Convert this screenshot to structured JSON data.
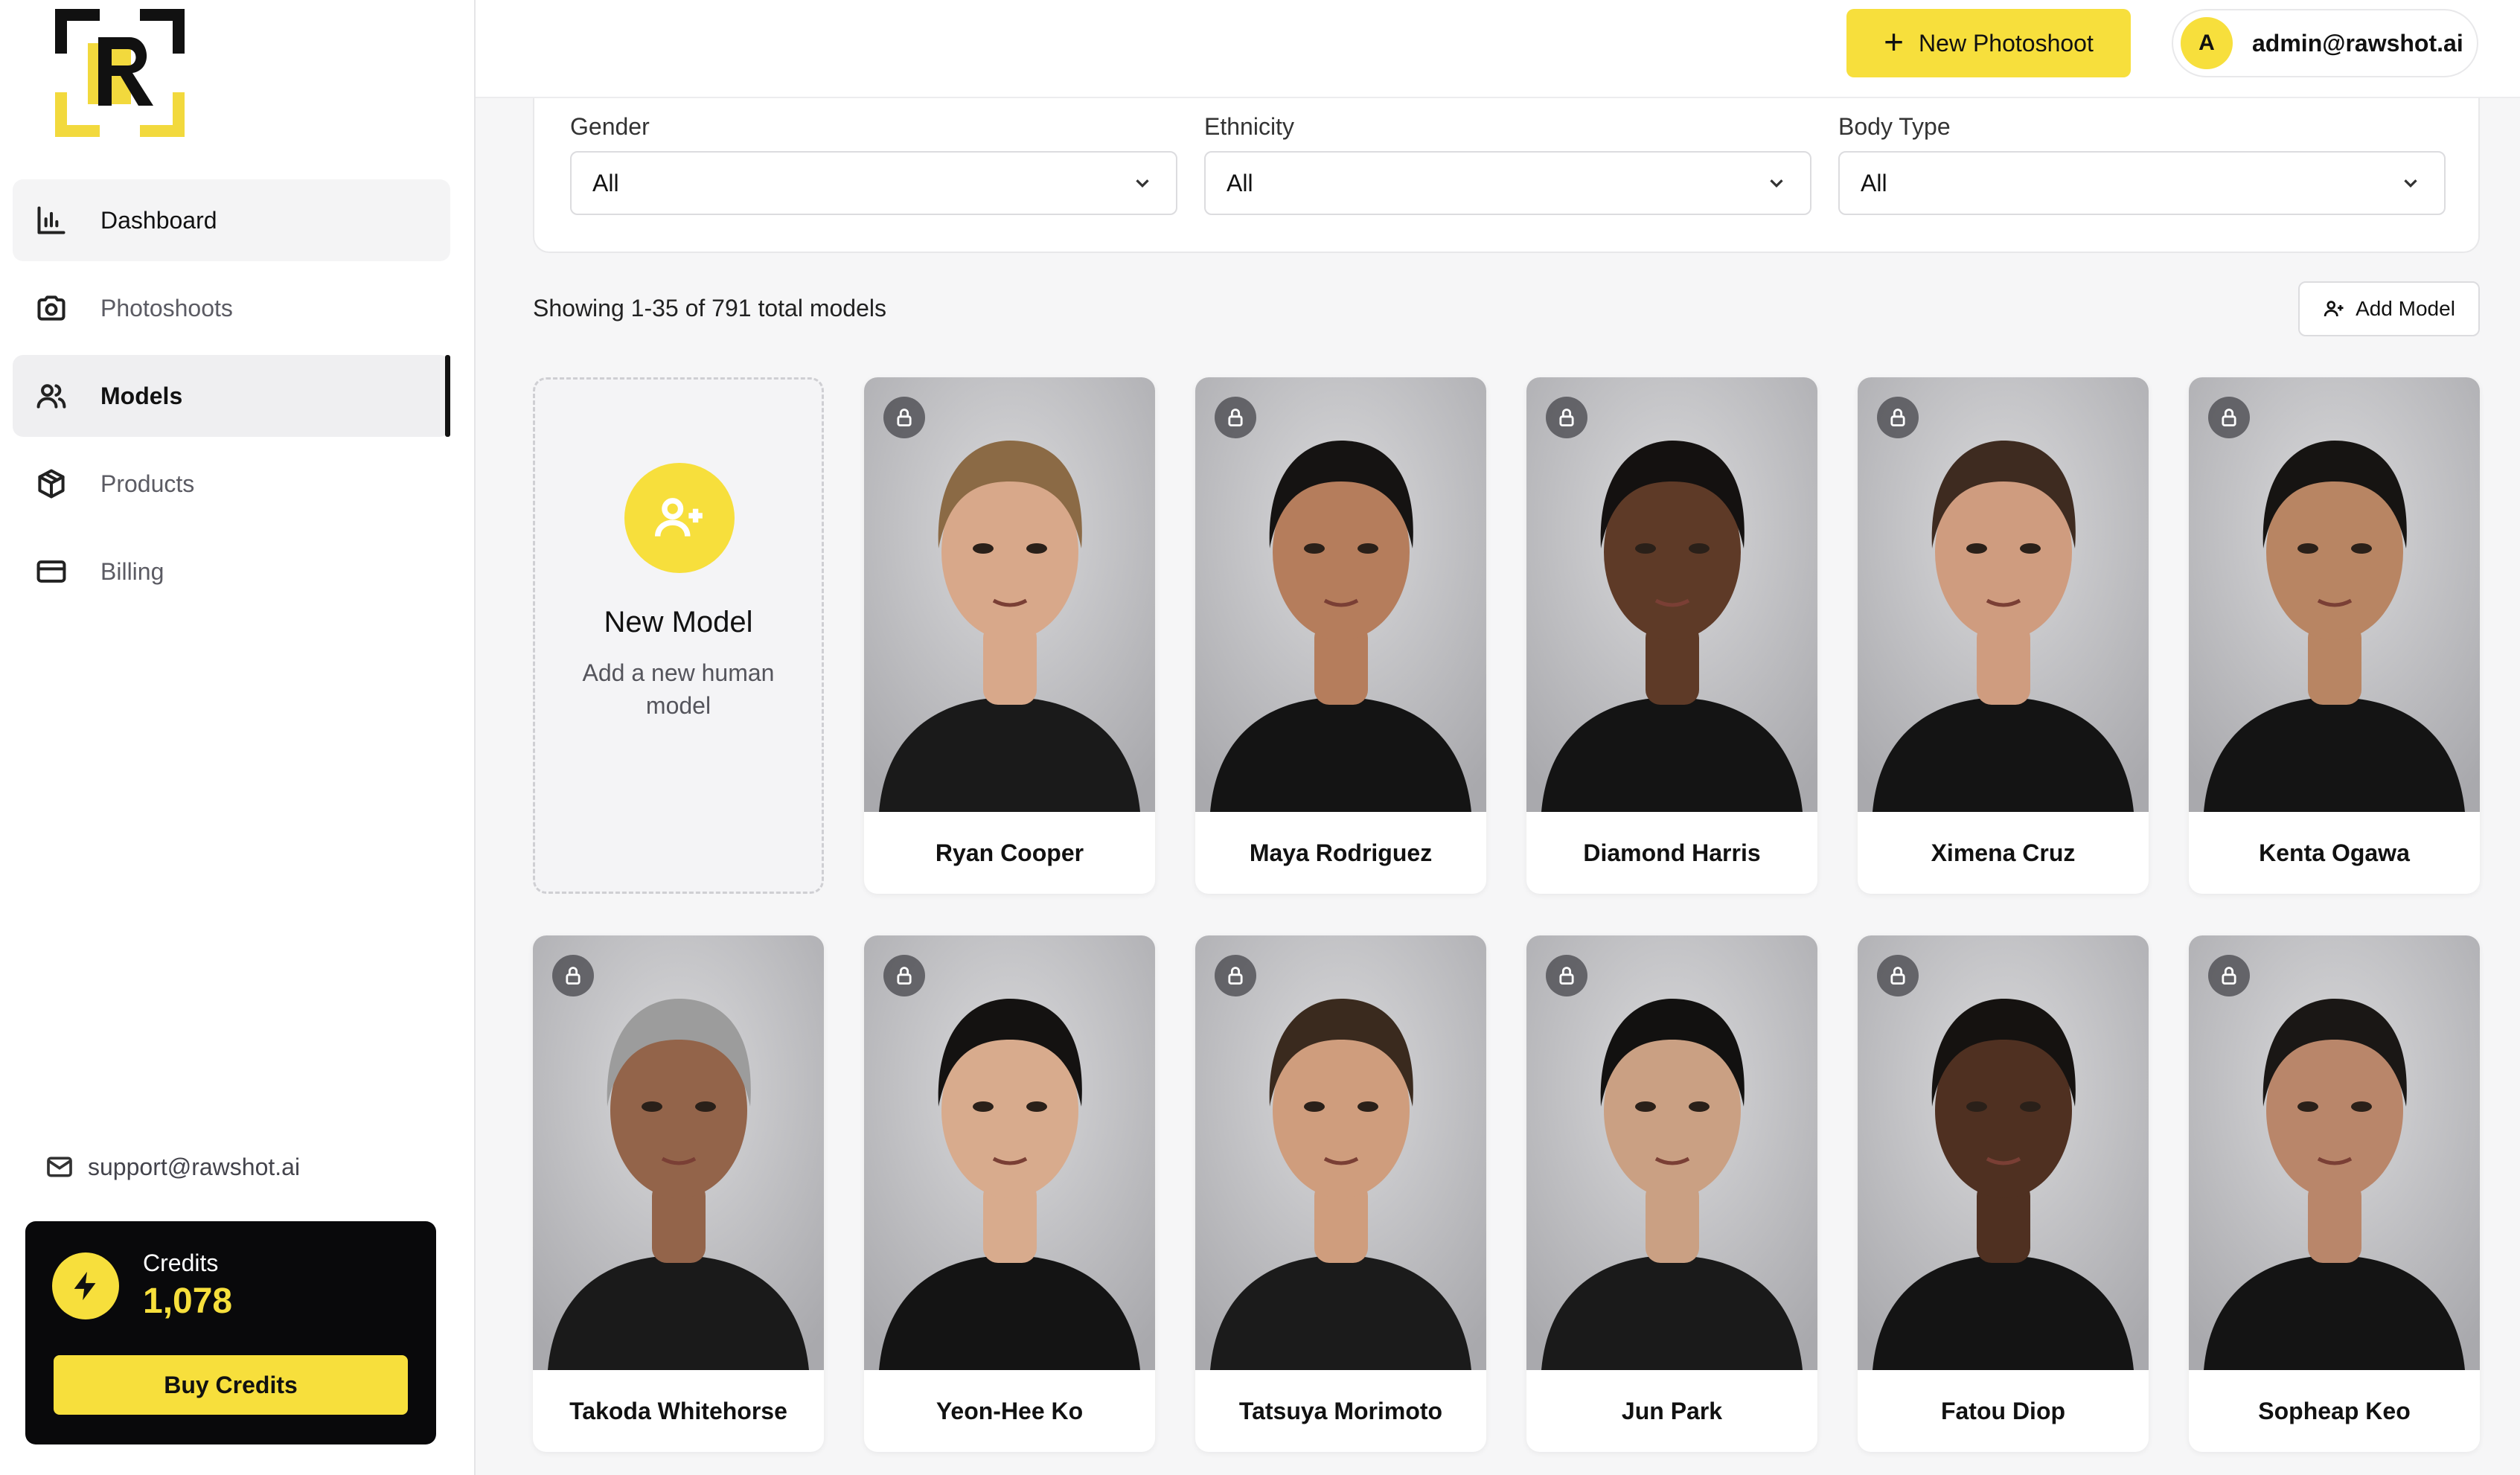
{
  "nav": {
    "items": [
      {
        "label": "Dashboard",
        "icon": "bar-chart-icon"
      },
      {
        "label": "Photoshoots",
        "icon": "camera-icon"
      },
      {
        "label": "Models",
        "icon": "users-icon"
      },
      {
        "label": "Products",
        "icon": "box-icon"
      },
      {
        "label": "Billing",
        "icon": "credit-card-icon"
      }
    ],
    "active": "Models"
  },
  "support": {
    "email": "support@rawshot.ai"
  },
  "credits": {
    "label": "Credits",
    "value": "1,078",
    "buy_label": "Buy Credits"
  },
  "header": {
    "new_photoshoot_label": "New Photoshoot",
    "avatar_initial": "A",
    "account_email": "admin@rawshot.ai"
  },
  "filters": [
    {
      "label": "Gender",
      "value": "All"
    },
    {
      "label": "Ethnicity",
      "value": "All"
    },
    {
      "label": "Body Type",
      "value": "All"
    }
  ],
  "listing": {
    "showing_text": "Showing 1-35 of 791 total models",
    "add_model_label": "Add Model"
  },
  "new_model_card": {
    "title": "New Model",
    "subtitle": "Add a new human model"
  },
  "models": [
    {
      "name": "Ryan Cooper",
      "skin": "#d8a88a",
      "hair": "#8b6a45",
      "shirt": "#1a1a1a"
    },
    {
      "name": "Maya Rodriguez",
      "skin": "#b57d5c",
      "hair": "#151312",
      "shirt": "#141414"
    },
    {
      "name": "Diamond Harris",
      "skin": "#5e3a27",
      "hair": "#141110",
      "shirt": "#141414"
    },
    {
      "name": "Ximena Cruz",
      "skin": "#cf9c7f",
      "hair": "#3e2b20",
      "shirt": "#141414"
    },
    {
      "name": "Kenta Ogawa",
      "skin": "#b88563",
      "hair": "#161412",
      "shirt": "#141414"
    },
    {
      "name": "Takoda Whitehorse",
      "skin": "#93644a",
      "hair": "#9c9c9c",
      "shirt": "#1a1a1a"
    },
    {
      "name": "Yeon-Hee Ko",
      "skin": "#d8ab8d",
      "hair": "#141211",
      "shirt": "#141414"
    },
    {
      "name": "Tatsuya Morimoto",
      "skin": "#cf9d7d",
      "hair": "#3a2a1e",
      "shirt": "#1b1b1b"
    },
    {
      "name": "Jun Park",
      "skin": "#caa083",
      "hair": "#121110",
      "shirt": "#1a1a1a"
    },
    {
      "name": "Fatou Diop",
      "skin": "#4f3021",
      "hair": "#151210",
      "shirt": "#141414"
    },
    {
      "name": "Sopheap Keo",
      "skin": "#b9866a",
      "hair": "#1a1715",
      "shirt": "#141414"
    }
  ]
}
